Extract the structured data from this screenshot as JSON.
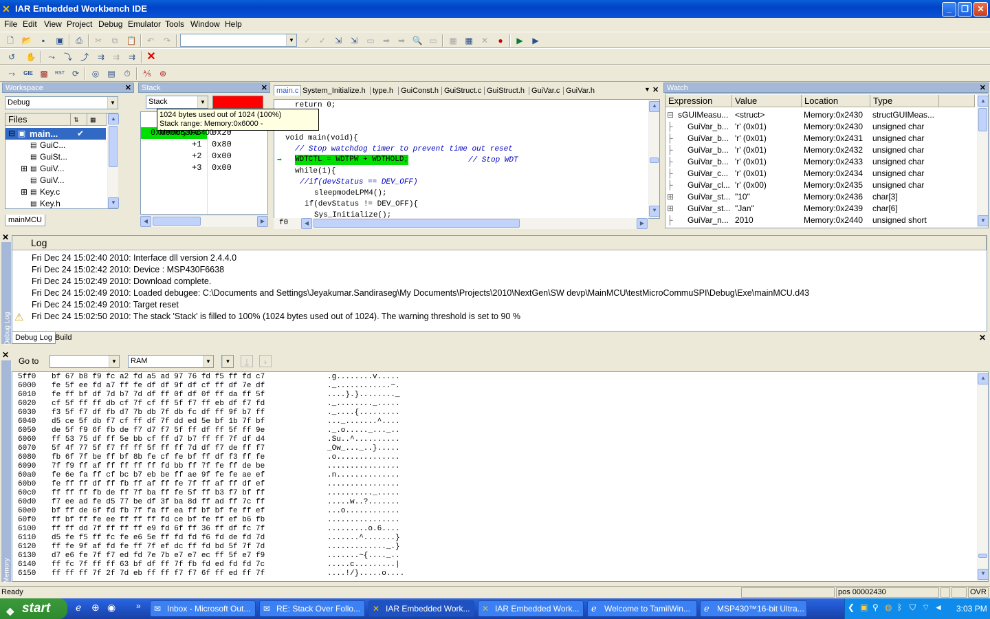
{
  "window": {
    "title": "IAR Embedded Workbench IDE"
  },
  "menu": [
    "File",
    "Edit",
    "View",
    "Project",
    "Debug",
    "Emulator",
    "Tools",
    "Window",
    "Help"
  ],
  "workspace": {
    "title": "Workspace",
    "config": "Debug",
    "files_header": "Files",
    "files": [
      "main...",
      "GuiC...",
      "GuiSt...",
      "GuiV...",
      "GuiV...",
      "Key.c",
      "Key.h"
    ],
    "tab": "mainMCU"
  },
  "stack": {
    "title": "Stack",
    "selector": "Stack",
    "tooltip1": "1024 bytes used out of 1024 (100%)",
    "tooltip2": "Stack range: Memory:0x6000 - Memory:0x6400",
    "rows": [
      {
        "loc": "0x000063FC",
        "val": "0x20"
      },
      {
        "loc": "+1",
        "val": "0x80"
      },
      {
        "loc": "+2",
        "val": "0x00"
      },
      {
        "loc": "+3",
        "val": "0x00"
      }
    ]
  },
  "editor": {
    "tabs": [
      "main.c",
      "System_Initialize.h",
      "type.h",
      "GuiConst.h",
      "GuiStruct.c",
      "GuiStruct.h",
      "GuiVar.c",
      "GuiVar.h"
    ],
    "lines": [
      "return 0;",
      "",
      "}",
      "void main(void){",
      "// Stop watchdog timer to prevent time out reset",
      "WDTCTL = WDTPW + WDTHOLD;",
      "// Stop WDT",
      "while(1){",
      "//if(devStatus == DEV_OFF)",
      "sleepmodeLPM4();",
      "if(devStatus != DEV_OFF){",
      "Sys_Initialize();"
    ],
    "bottom_label": "f0"
  },
  "watch": {
    "title": "Watch",
    "headers": [
      "Expression",
      "Value",
      "Location",
      "Type"
    ],
    "rows": [
      {
        "e": "sGUIMeasu...",
        "v": "<struct>",
        "l": "Memory:0x2430",
        "t": "structGUIMeas..."
      },
      {
        "e": "GuiVar_b...",
        "v": "'r' (0x01)",
        "l": "Memory:0x2430",
        "t": "unsigned char"
      },
      {
        "e": "GuiVar_b...",
        "v": "'r' (0x01)",
        "l": "Memory:0x2431",
        "t": "unsigned char"
      },
      {
        "e": "GuiVar_b...",
        "v": "'r' (0x01)",
        "l": "Memory:0x2432",
        "t": "unsigned char"
      },
      {
        "e": "GuiVar_b...",
        "v": "'r' (0x01)",
        "l": "Memory:0x2433",
        "t": "unsigned char"
      },
      {
        "e": "GuiVar_c...",
        "v": "'r' (0x01)",
        "l": "Memory:0x2434",
        "t": "unsigned char"
      },
      {
        "e": "GuiVar_cl...",
        "v": "'r' (0x00)",
        "l": "Memory:0x2435",
        "t": "unsigned char"
      },
      {
        "e": "GuiVar_st...",
        "v": "\"10\"",
        "l": "Memory:0x2436",
        "t": "char[3]"
      },
      {
        "e": "GuiVar_st...",
        "v": "\"Jan\"",
        "l": "Memory:0x2439",
        "t": "char[6]"
      },
      {
        "e": "GuiVar_n...",
        "v": "2010",
        "l": "Memory:0x2440",
        "t": "unsigned short"
      }
    ]
  },
  "log": {
    "header": "Log",
    "side": "Debug Log",
    "tabs": [
      "Debug Log",
      "Build"
    ],
    "lines": [
      "Fri Dec 24 15:02:40 2010: Interface dll version 2.4.4.0",
      "Fri Dec 24 15:02:42 2010: Device : MSP430F6638",
      "Fri Dec 24 15:02:49 2010: Download complete.",
      "Fri Dec 24 15:02:49 2010: Loaded debugee: C:\\Documents and Settings\\Jeyakumar.Sandiraseg\\My Documents\\Projects\\2010\\NextGen\\SW devp\\MainMCU\\testMicroCommuSPI\\Debug\\Exe\\mainMCU.d43",
      "Fri Dec 24 15:02:49 2010: Target reset",
      "Fri Dec 24 15:02:50 2010: The stack 'Stack' is filled to 100% (1024 bytes used out of 1024). The warning threshold is set to 90 %"
    ]
  },
  "memory": {
    "goto_label": "Go to",
    "zone": "RAM",
    "side": "Memory",
    "rows": [
      {
        "a": "5ff0",
        "h": "bf 67 b8 f9 fc a2 fd a5 ad 97 76 fd f5 ff fd c7",
        "c": ".g........v....."
      },
      {
        "a": "6000",
        "h": "fe 5f ee fd a7 ff fe df df 9f df cf ff df 7e df",
        "c": "._............~."
      },
      {
        "a": "6010",
        "h": "fe ff bf df 7d b7 7d df ff 0f df 0f ff da ff 5f",
        "c": "....}.}........_"
      },
      {
        "a": "6020",
        "h": "cf 5f ff ff db cf 7f cf ff 5f f7 ff eb df f7 fd",
        "c": "._........_....."
      },
      {
        "a": "6030",
        "h": "f3 5f f7 df fb d7 7b db 7f db fc df ff 9f b7 ff",
        "c": "._....{........."
      },
      {
        "a": "6040",
        "h": "d5 ce 5f db f7 cf ff df 7f dd ed 5e bf 1b 7f bf",
        "c": "..._.......^...."
      },
      {
        "a": "6050",
        "h": "de 5f f9 6f fb de f7 d7 f7 5f ff df ff 5f ff 9e",
        "c": "._.o....._..._.."
      },
      {
        "a": "6060",
        "h": "ff 53 75 df ff 5e bb cf ff d7 b7 ff ff 7f df d4",
        "c": ".Su..^.........."
      },
      {
        "a": "6070",
        "h": "5f 4f 77 5f f7 ff ff 5f ff ff 7d df f7 de ff f7",
        "c": "_Ow_..._..}....."
      },
      {
        "a": "6080",
        "h": "fb 6f 7f be ff bf 8b fe cf fe bf ff df f3 ff fe",
        "c": ".o.............."
      },
      {
        "a": "6090",
        "h": "7f f9 ff af ff ff ff ff fd bb ff 7f fe ff de be",
        "c": "................"
      },
      {
        "a": "60a0",
        "h": "fe 6e fa ff cf bc b7 eb be ff ae 9f fe fe ae ef",
        "c": ".n.............."
      },
      {
        "a": "60b0",
        "h": "fe ff ff df ff fb ff af ff fe 7f ff af ff df ef",
        "c": "................"
      },
      {
        "a": "60c0",
        "h": "ff ff ff fb de ff 7f ba ff fe 5f ff b3 f7 bf ff",
        "c": ".........._....."
      },
      {
        "a": "60d0",
        "h": "f7 ee ad fe d5 77 be df 3f ba 8d ff ad ff 7c ff",
        "c": ".....w..?.......",
        "x": ""
      },
      {
        "a": "60e0",
        "h": "bf ff de 6f fd fb 7f fa ff ea ff bf bf fe ff ef",
        "c": "...o............"
      },
      {
        "a": "60f0",
        "h": "ff bf ff fe ee ff ff ff fd ce bf fe ff ef b6 fb",
        "c": "................"
      },
      {
        "a": "6100",
        "h": "ff ff dd 7f ff ff ff e9 fd 6f ff 36 ff df fc 7f",
        "c": ".........o.6...."
      },
      {
        "a": "6110",
        "h": "d5 fe f5 ff fc fe e6 5e ff fd fd f6 fd de fd 7d",
        "c": ".......^.......}"
      },
      {
        "a": "6120",
        "h": "ff fe 9f af fd fe ff 7f ef dc ff fd bd 5f 7f 7d",
        "c": "............._.}"
      },
      {
        "a": "6130",
        "h": "d7 e6 fe 7f f7 ed fd 7e 7b e7 e7 ec ff 5f e7 f9",
        "c": ".......~{...._.."
      },
      {
        "a": "6140",
        "h": "ff fc 7f ff ff 63 bf df ff 7f fb fd ed fd fd 7c",
        "c": ".....c.........|"
      },
      {
        "a": "6150",
        "h": "ff ff ff 7f 2f 7d eb ff ff f7 f7 6f ff ed ff 7f",
        "c": "....!/}.....o...."
      }
    ]
  },
  "status": {
    "left": "Ready",
    "pos": "pos 00002430",
    "ovr": "OVR"
  },
  "taskbar": {
    "start": "start",
    "tasks": [
      "Inbox - Microsoft Out...",
      "RE: Stack Over Follo...",
      "IAR Embedded Work...",
      "IAR Embedded Work...",
      "Welcome to TamilWin...",
      "MSP430™16-bit Ultra..."
    ],
    "time": "3:03 PM"
  },
  "colors": {
    "titlebar": "#0A52D6",
    "highlight": "#00E000",
    "stack_bar": "#FF0000",
    "comment": "#0000C0"
  }
}
